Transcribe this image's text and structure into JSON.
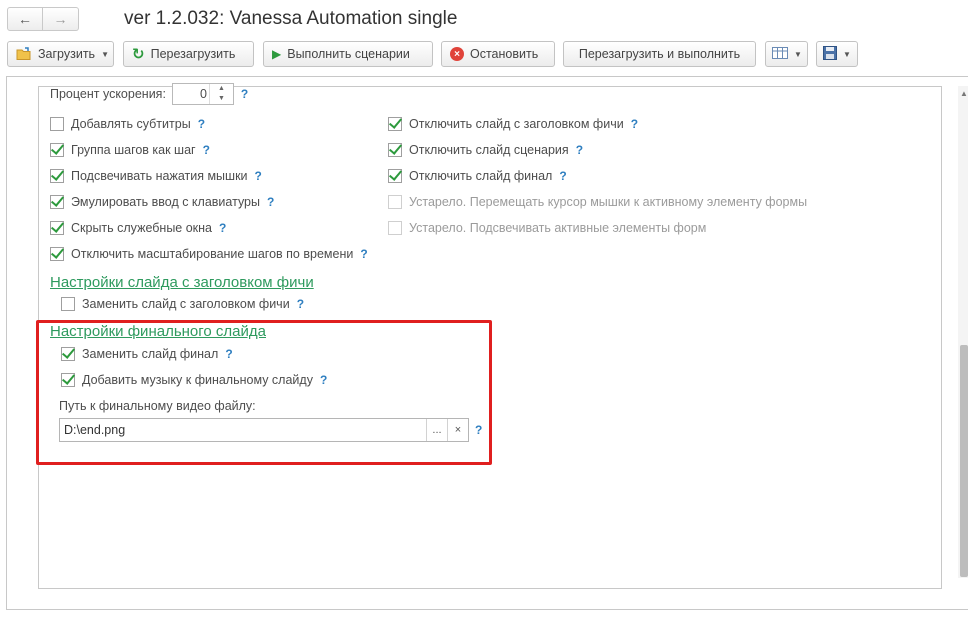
{
  "window": {
    "title": "ver 1.2.032: Vanessa Automation single",
    "back_icon": "arrow-left-icon",
    "forward_icon": "arrow-right-icon"
  },
  "toolbar": {
    "load_label": "Загрузить",
    "reload_label": "Перезагрузить",
    "run_label": "Выполнить сценарии",
    "stop_label": "Остановить",
    "reload_run_label": "Перезагрузить и выполнить"
  },
  "form": {
    "speed": {
      "label": "Процент ускорения:",
      "value": "0"
    },
    "help": "?",
    "left_options": [
      {
        "label": "Добавлять субтитры",
        "checked": false
      },
      {
        "label": "Группа шагов как шаг",
        "checked": true
      },
      {
        "label": "Подсвечивать нажатия мышки",
        "checked": true
      },
      {
        "label": "Эмулировать ввод с клавиатуры",
        "checked": true
      },
      {
        "label": "Скрыть служебные окна",
        "checked": true
      },
      {
        "label": "Отключить масштабирование шагов по времени",
        "checked": true
      }
    ],
    "right_options": [
      {
        "label": "Отключить слайд с заголовком фичи",
        "checked": true
      },
      {
        "label": "Отключить слайд сценария",
        "checked": true
      },
      {
        "label": "Отключить слайд финал",
        "checked": true
      },
      {
        "label": "Устарело. Перемещать курсор мышки к активному элементу формы",
        "checked": false,
        "disabled": true
      },
      {
        "label": "Устарело. Подсвечивать активные элементы форм",
        "checked": false,
        "disabled": true
      }
    ],
    "feature_title_section": {
      "title": "Настройки  слайда с заголовком фичи",
      "replace": {
        "label": "Заменить слайд с заголовком фичи",
        "checked": false
      }
    },
    "final_section": {
      "title": "Настройки финального слайда",
      "replace": {
        "label": "Заменить слайд финал",
        "checked": true
      },
      "music": {
        "label": "Добавить музыку к финальному слайду",
        "checked": true
      },
      "path_label": "Путь к финальному видео файлу:",
      "path_value": "D:\\end.png",
      "browse_label": "...",
      "clear_label": "×"
    }
  },
  "colors": {
    "highlight": "#e01f1f",
    "section_link": "#2e9a5e",
    "check": "#2d9a3d",
    "help": "#2f7fc0"
  }
}
